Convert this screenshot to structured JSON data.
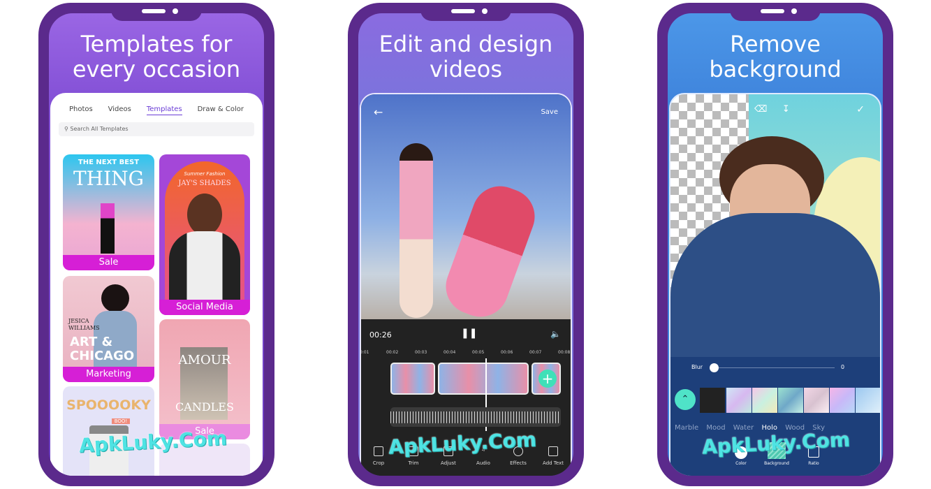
{
  "phones": [
    {
      "headline": "Templates for\nevery occasion",
      "tabs": [
        "Photos",
        "Videos",
        "Templates",
        "Draw & Color"
      ],
      "active_tab": "Templates",
      "search_placeholder": "Search All Templates",
      "templates": [
        {
          "label": "Sale",
          "lines": [
            "THE NEXT BEST",
            "THING"
          ]
        },
        {
          "label": "Social Media",
          "lines": [
            "Summer Fashion",
            "JAY'S SHADES"
          ]
        },
        {
          "label": "Marketing",
          "lines": [
            "JESICA",
            "WILLIAMS",
            "ART &",
            "CHICAGO"
          ]
        },
        {
          "label": "Sale",
          "lines": [
            "AMOUR",
            "CANDLES"
          ]
        },
        {
          "label": "",
          "lines": [
            "SPOOOOKY",
            "BOO!"
          ]
        }
      ]
    },
    {
      "headline": "Edit and design\nvideos",
      "save_label": "Save",
      "current_time": "00:26",
      "ticks": [
        "0:01",
        "00:02",
        "00:03",
        "00:04",
        "00:05",
        "00:06",
        "00:07",
        "00:08"
      ],
      "tools": [
        "Crop",
        "Trim",
        "Adjust",
        "Audio",
        "Effects",
        "Add Text"
      ]
    },
    {
      "headline": "Remove\nbackground",
      "blur_label": "Blur",
      "blur_value": "0",
      "categories": [
        "Marble Mood",
        "Water",
        "Holo",
        "Wood",
        "Sky"
      ],
      "active_category": "Holo",
      "bottom_tools": [
        "Color",
        "Background",
        "Ratio"
      ]
    }
  ],
  "watermark": "ApkLuky.Com",
  "colors": {
    "frame": "#5b2a8c",
    "accent": "#6a3cd6",
    "label_magenta": "#d61fd6",
    "teal": "#4fe3c8"
  }
}
